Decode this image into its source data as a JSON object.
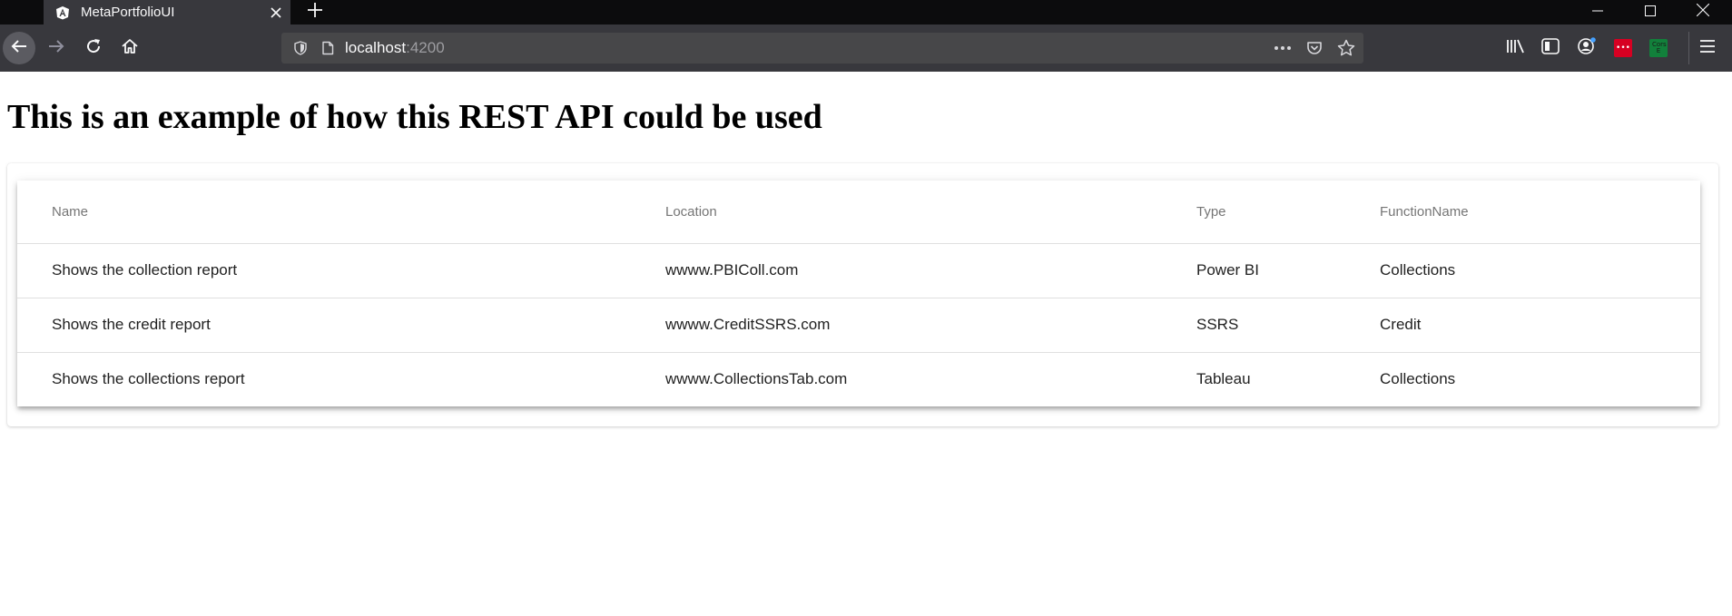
{
  "browser": {
    "tab_title": "MetaPortfolioUI",
    "url_host": "localhost",
    "url_port": ":4200",
    "icons": {
      "favicon": "angular-a-icon",
      "tab_close": "close-icon",
      "new_tab": "plus-icon",
      "back": "back-arrow-icon",
      "forward": "forward-arrow-icon",
      "reload": "reload-icon",
      "home": "home-icon",
      "tracking": "shield-icon",
      "page": "page-icon",
      "page_actions": "more-dots-icon",
      "pocket": "pocket-icon",
      "bookmark": "star-icon",
      "library": "library-icon",
      "sidebar": "sidebar-icon",
      "account": "account-icon",
      "menu": "hamburger-menu-icon"
    },
    "extension_1_label": "•••",
    "extension_2_label": "Cors E",
    "colors": {
      "tabbar": "#0c0c0d",
      "toolbar": "#38383d",
      "urlbar": "#474749",
      "extension_red": "#d70022",
      "extension_green": "#12803b"
    }
  },
  "page": {
    "title": "This is an example of how this REST API could be used",
    "table": {
      "headers": [
        "Name",
        "Location",
        "Type",
        "FunctionName"
      ],
      "rows": [
        [
          "Shows the collection report",
          "wwww.PBIColl.com",
          "Power BI",
          "Collections"
        ],
        [
          "Shows the credit report",
          "wwww.CreditSSRS.com",
          "SSRS",
          "Credit"
        ],
        [
          "Shows the collections report",
          "wwww.CollectionsTab.com",
          "Tableau",
          "Collections"
        ]
      ]
    }
  }
}
